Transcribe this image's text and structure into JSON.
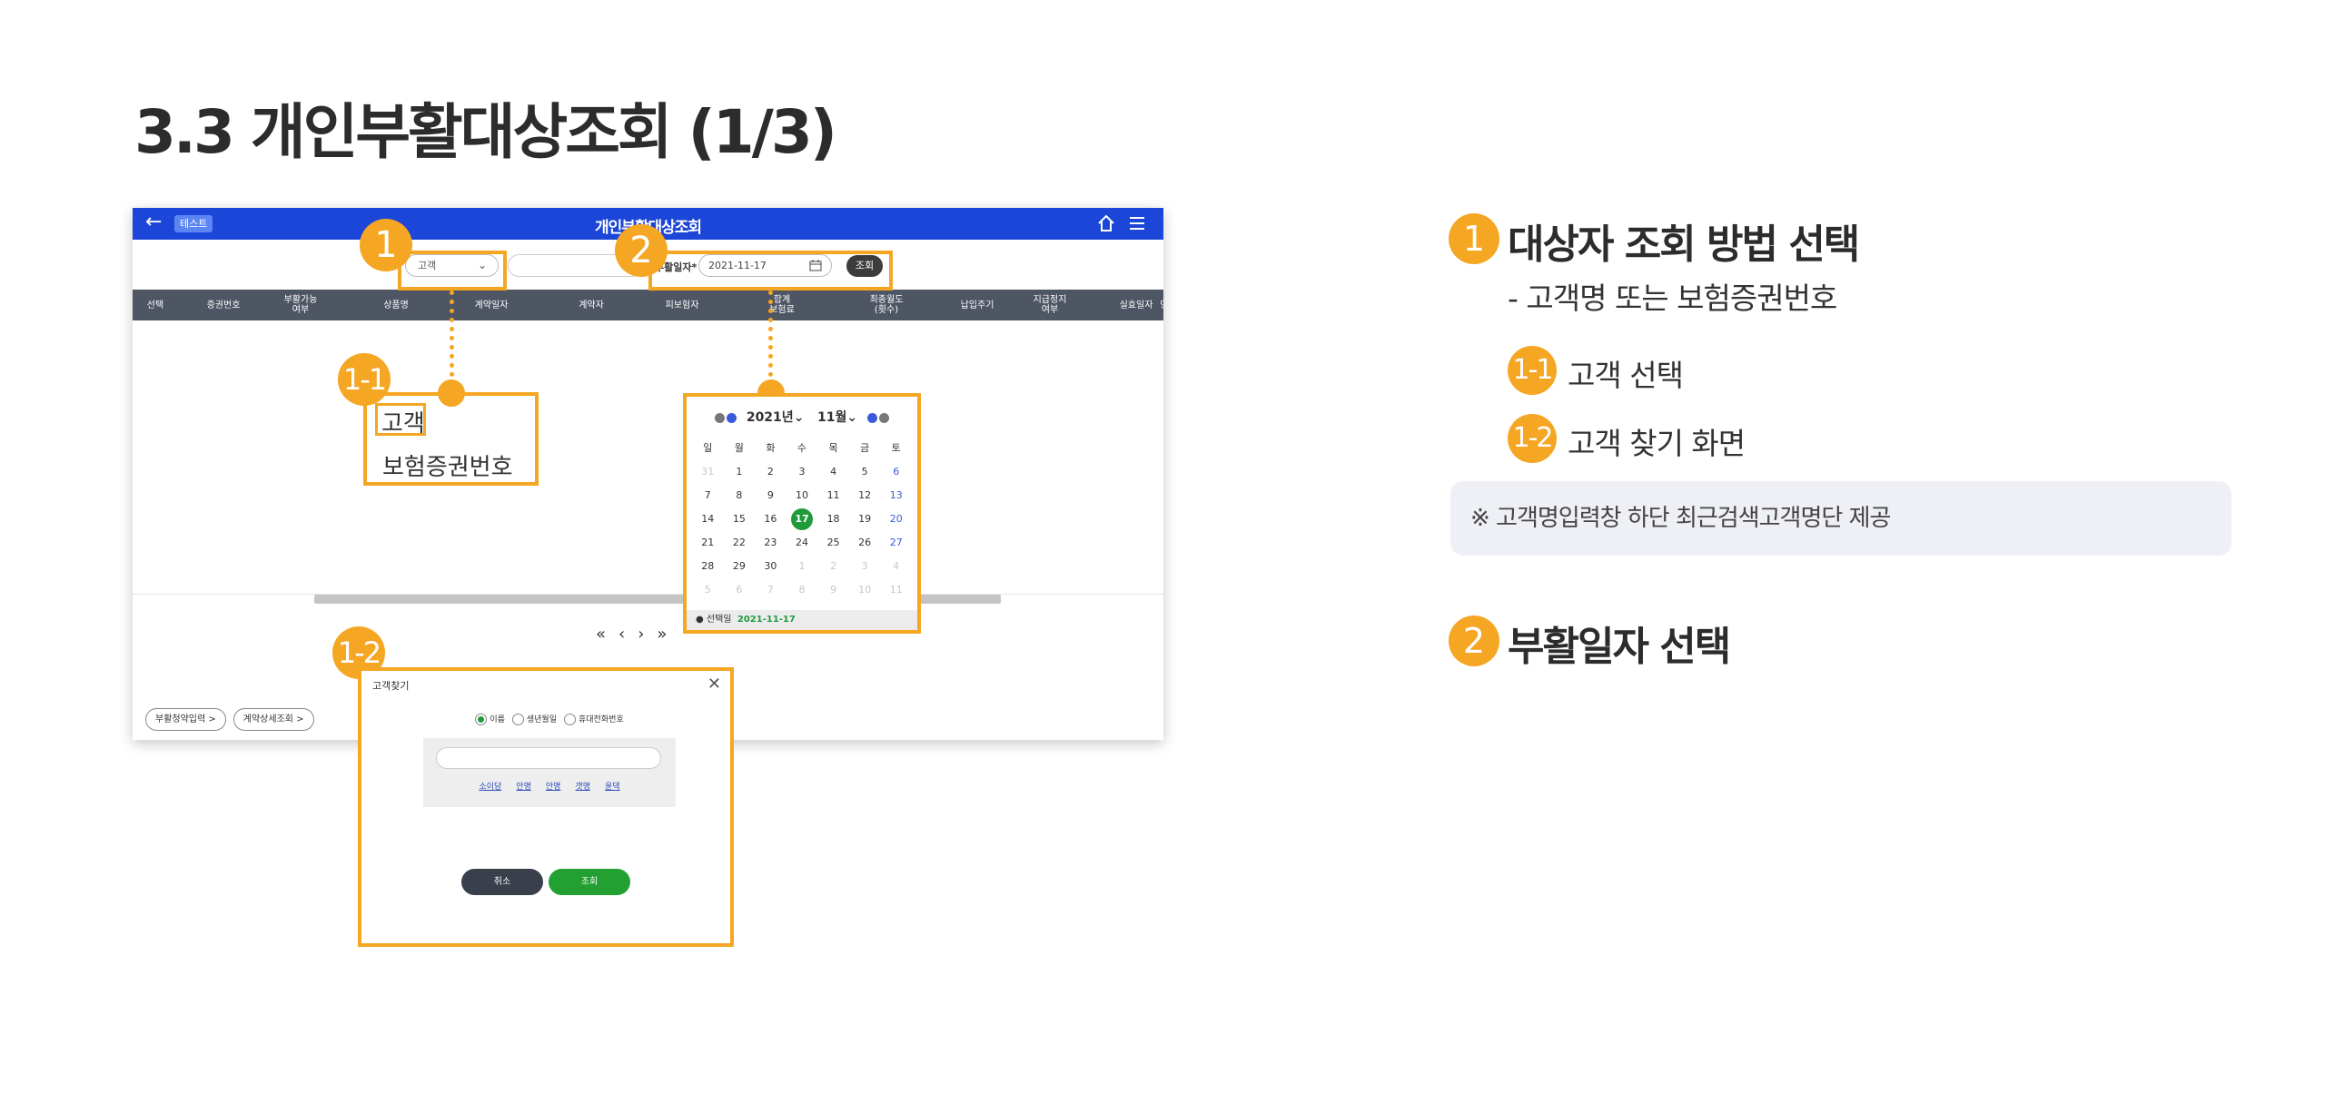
{
  "slide": {
    "title": "3.3 개인부활대상조회 (1/3)"
  },
  "app": {
    "test_badge": "테스트",
    "title": "개인부활대상조회",
    "filter": {
      "customer_select": "고객",
      "customer_input": "",
      "date_label": "부활일자*",
      "date_value": "2021-11-17",
      "search_button": "조회"
    },
    "columns": [
      "선택",
      "증권번호",
      "부활가능\n여부",
      "상품명",
      "계약일자",
      "계약자",
      "피보험자",
      "합계\n보험료",
      "최종월도\n(횟수)",
      "납입주기",
      "지급정지\n여부",
      "실효일자",
      "연체유"
    ],
    "pager": [
      "«",
      "‹",
      "›",
      "»"
    ],
    "bottom_buttons": [
      "부활청약입력 >",
      "계약상세조회 >"
    ]
  },
  "callouts": {
    "c1": "1",
    "c2": "2",
    "c1_1": "1-1",
    "c1_2": "1-2",
    "options": {
      "first": "고객",
      "second": "보험증권번호"
    }
  },
  "calendar": {
    "year": "2021년",
    "month": "11월",
    "weekdays": [
      "일",
      "월",
      "화",
      "수",
      "목",
      "금",
      "토"
    ],
    "days": [
      "31",
      "1",
      "2",
      "3",
      "4",
      "5",
      "6",
      "7",
      "8",
      "9",
      "10",
      "11",
      "12",
      "13",
      "14",
      "15",
      "16",
      "17",
      "18",
      "19",
      "20",
      "21",
      "22",
      "23",
      "24",
      "25",
      "26",
      "27",
      "28",
      "29",
      "30",
      "1",
      "2",
      "3",
      "4",
      "5",
      "6",
      "7",
      "8",
      "9",
      "10",
      "11"
    ],
    "selected": "17",
    "footer_label": "선택일",
    "footer_value": "2021-11-17"
  },
  "popup": {
    "title": "고객찾기",
    "close": "✕",
    "radios": [
      "이름",
      "생년월일",
      "휴대전화번호"
    ],
    "chars": [
      "소이당",
      "안명",
      "안명",
      "갯명",
      "윤댁"
    ],
    "cancel": "취소",
    "ok": "조회"
  },
  "description": {
    "item1": {
      "badge": "1",
      "title": "대상자 조회 방법 선택",
      "sub": "- 고객명 또는 보험증권번호"
    },
    "item1_1": {
      "badge": "1-1",
      "text": "고객 선택"
    },
    "item1_2": {
      "badge": "1-2",
      "text": "고객 찾기 화면"
    },
    "note": "※ 고객명입력창 하단 최근검색고객명단 제공",
    "item2": {
      "badge": "2",
      "title": "부활일자 선택"
    }
  },
  "colors": {
    "accent": "#f5a623",
    "appbar": "#1b46d8",
    "green": "#1e9a3b"
  }
}
